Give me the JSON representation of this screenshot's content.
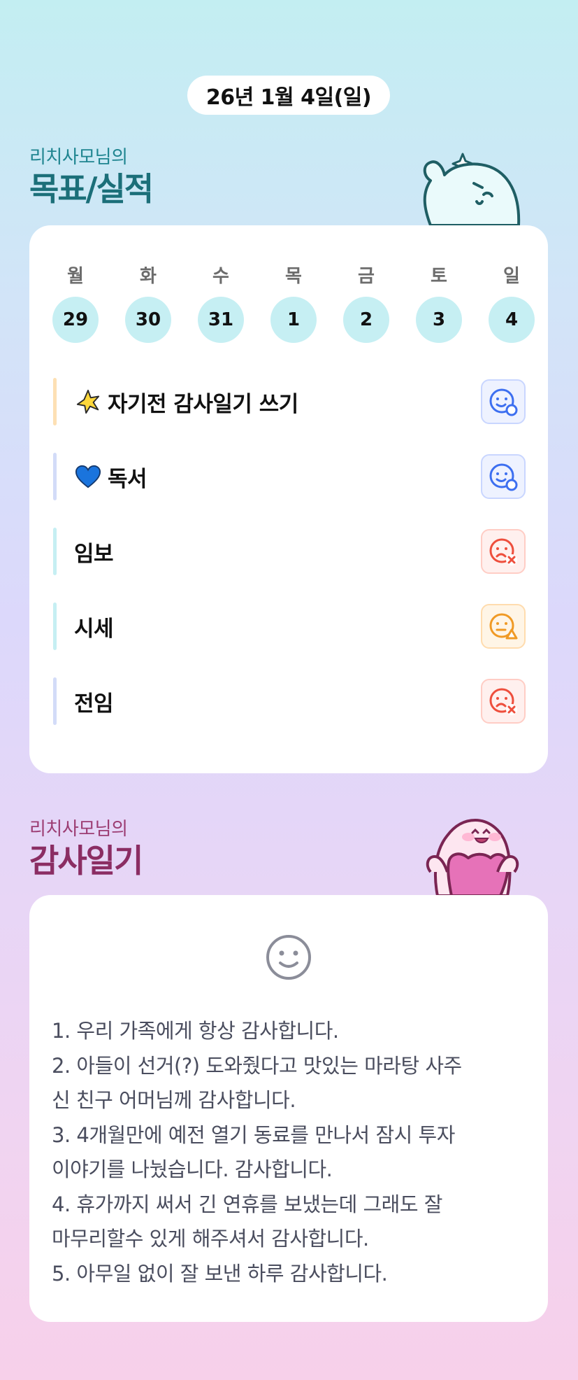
{
  "header": {
    "date": "26년 1월 4일(일)"
  },
  "goals_section": {
    "subtitle": "리치사모님의",
    "title": "목표/실적",
    "week": [
      {
        "day": "월",
        "date": "29"
      },
      {
        "day": "화",
        "date": "30"
      },
      {
        "day": "수",
        "date": "31"
      },
      {
        "day": "목",
        "date": "1"
      },
      {
        "day": "금",
        "date": "2"
      },
      {
        "day": "토",
        "date": "3"
      },
      {
        "day": "일",
        "date": "4"
      }
    ],
    "goals": [
      {
        "label": "자기전 감사일기 쓰기",
        "icon": "star-icon",
        "status": "done-smile-icon",
        "status_color": "#3d6ff0",
        "bar_color": "#fde0b4"
      },
      {
        "label": "독서",
        "icon": "heart-icon",
        "status": "done-smile-icon",
        "status_color": "#3d6ff0",
        "bar_color": "#d3dcf8"
      },
      {
        "label": "임보",
        "icon": "",
        "status": "fail-frown-icon",
        "status_color": "#ee4e3c",
        "bar_color": "#c6eff3"
      },
      {
        "label": "시세",
        "icon": "",
        "status": "partial-meh-icon",
        "status_color": "#f09a25",
        "bar_color": "#c6eff3"
      },
      {
        "label": "전임",
        "icon": "",
        "status": "fail-frown-icon",
        "status_color": "#ee4e3c",
        "bar_color": "#d3dcf8"
      }
    ]
  },
  "diary_section": {
    "subtitle": "리치사모님의",
    "title": "감사일기",
    "mood_icon": "smile-icon",
    "lines": [
      "1. 우리 가족에게 항상 감사합니다.",
      "2. 아들이 선거(?) 도와줬다고 맛있는 마라탕 사주",
      "신 친구 어머님께 감사합니다.",
      "3. 4개월만에 예전 열기 동료를 만나서 잠시 투자",
      "이야기를 나눴습니다. 감사합니다.",
      "4. 휴가까지 써서 긴 연휴를 보냈는데 그래도 잘",
      "마무리할수 있게 해주셔서 감사합니다.",
      "5. 아무일 없이 잘 보낸 하루 감사합니다."
    ]
  },
  "colors": {
    "teal_title": "#1b6f79",
    "plum_title": "#8b2d63",
    "date_circle": "#c6eff3"
  }
}
